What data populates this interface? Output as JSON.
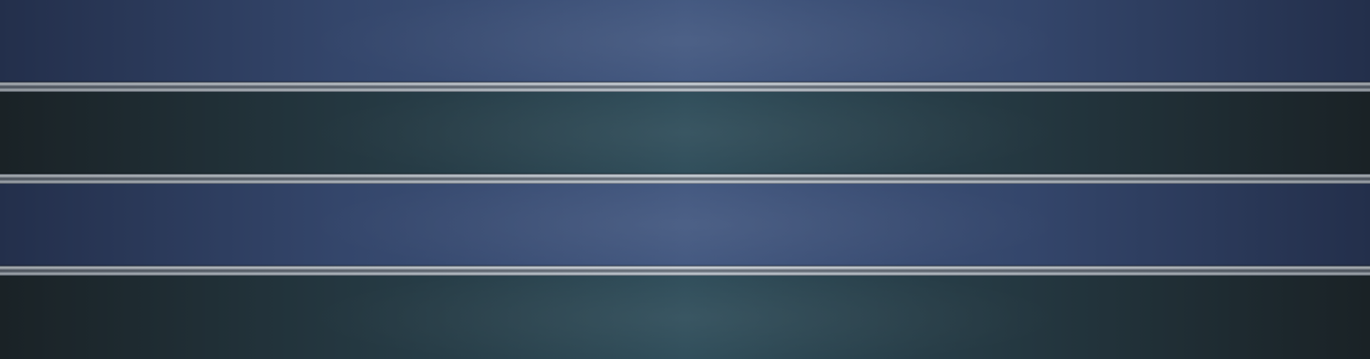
{
  "colors": {
    "band_blue_edge": "#232f4b",
    "band_blue_center": "#435880",
    "band_teal_edge": "#1a2226",
    "band_teal_center": "#2f4d5a",
    "rail_highlight": "#d7dde3",
    "rail_shadow": "#535b66"
  },
  "bands": [
    {
      "tone": "blue"
    },
    {
      "tone": "teal"
    },
    {
      "tone": "blue"
    },
    {
      "tone": "teal"
    }
  ]
}
